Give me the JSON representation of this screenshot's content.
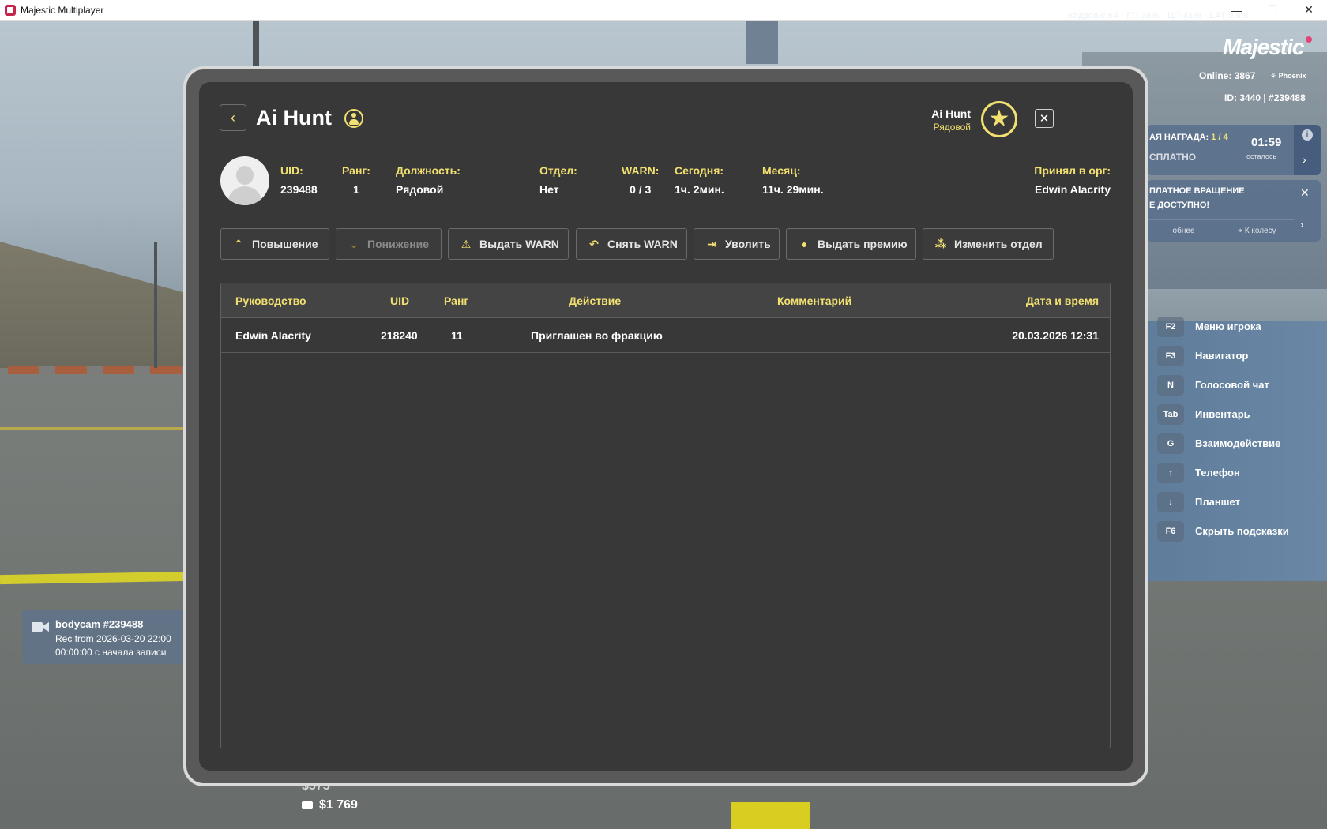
{
  "window": {
    "title": "Majestic Multiplayer",
    "minimize": "—",
    "maximize": "☐",
    "close": "✕"
  },
  "hud": {
    "fps_line": "кадров/с 64 · ГП 38% · ЦП 41% · LAT 0 ms",
    "logo": "Majestic",
    "online": "Online: 3867",
    "server": "Phoenix",
    "id_line": "ID: 3440 | #239488",
    "reward": {
      "title_prefix": "АЯ НАГРАДА:",
      "progress": "1 / 4",
      "status": "СПЛАТНО",
      "time": "01:59",
      "time_label": "осталось",
      "info": "i"
    },
    "wheel": {
      "line1": "ПЛАТНОЕ ВРАЩЕНИЕ",
      "line2": "Е ДОСТУПНО!",
      "left_link": "обнее",
      "right_link": "К колесу"
    },
    "hints": [
      {
        "key": "F2",
        "label": "Меню игрока"
      },
      {
        "key": "F3",
        "label": "Навигатор"
      },
      {
        "key": "N",
        "label": "Голосовой чат"
      },
      {
        "key": "Tab",
        "label": "Инвентарь"
      },
      {
        "key": "G",
        "label": "Взаимодействие"
      },
      {
        "key": "↑",
        "label": "Телефон"
      },
      {
        "key": "↓",
        "label": "Планшет"
      },
      {
        "key": "F6",
        "label": "Скрыть подсказки"
      }
    ],
    "bodycam": {
      "title": "bodycam #239488",
      "line2": "Rec from 2026-03-20 22:00",
      "line3": "00:00:00 с начала записи"
    },
    "money_cash": "$575",
    "money_bank": "$1 769"
  },
  "tablet": {
    "player_name": "Ai Hunt",
    "header_name": "Ai Hunt",
    "header_rank": "Рядовой",
    "info": [
      {
        "label": "UID:",
        "value": "239488"
      },
      {
        "label": "Ранг:",
        "value": "1"
      },
      {
        "label": "Должность:",
        "value": "Рядовой"
      },
      {
        "label": "Отдел:",
        "value": "Нет"
      },
      {
        "label": "WARN:",
        "value": "0 / 3"
      },
      {
        "label": "Сегодня:",
        "value": "1ч. 2мин."
      },
      {
        "label": "Месяц:",
        "value": "11ч. 29мин."
      },
      {
        "label": "Принял в орг:",
        "value": "Edwin Alacrity"
      }
    ],
    "actions": [
      {
        "label": "Повышение",
        "icon": "chevron-up-icon"
      },
      {
        "label": "Понижение",
        "icon": "chevron-down-icon",
        "disabled": true
      },
      {
        "label": "Выдать WARN",
        "icon": "warn-icon"
      },
      {
        "label": "Снять WARN",
        "icon": "undo-icon"
      },
      {
        "label": "Уволить",
        "icon": "fire-icon"
      },
      {
        "label": "Выдать премию",
        "icon": "coin-icon"
      },
      {
        "label": "Изменить отдел",
        "icon": "org-icon"
      }
    ],
    "table": {
      "headers": [
        "Руководство",
        "UID",
        "Ранг",
        "Действие",
        "Комментарий",
        "Дата и время"
      ],
      "rows": [
        [
          "Edwin Alacrity",
          "218240",
          "11",
          "Приглашен во фракцию",
          "",
          "20.03.2026 12:31"
        ]
      ]
    }
  }
}
